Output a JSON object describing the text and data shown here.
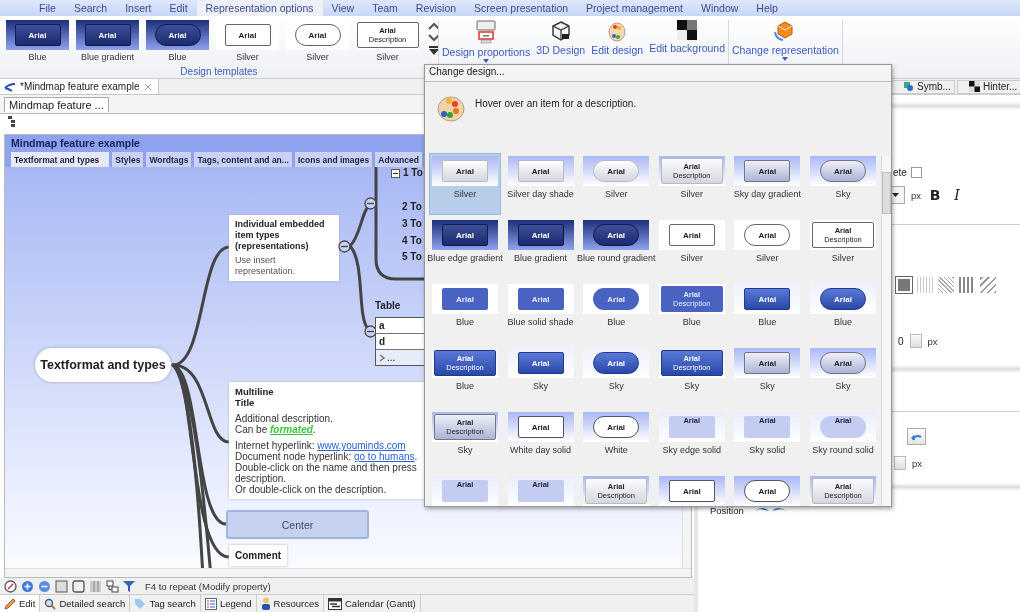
{
  "menu": [
    {
      "label": "File",
      "selected": false
    },
    {
      "label": "Search",
      "selected": false
    },
    {
      "label": "Insert",
      "selected": false
    },
    {
      "label": "Edit",
      "selected": false
    },
    {
      "label": "Representation options",
      "selected": true
    },
    {
      "label": "View",
      "selected": false
    },
    {
      "label": "Team",
      "selected": false
    },
    {
      "label": "Revision",
      "selected": false
    },
    {
      "label": "Screen presentation",
      "selected": false
    },
    {
      "label": "Project management",
      "selected": false
    },
    {
      "label": "Window",
      "selected": false
    },
    {
      "label": "Help",
      "selected": false
    }
  ],
  "ribbon": {
    "templates": [
      {
        "label": "Blue",
        "title": "Arial",
        "rounded": false,
        "kind": "navy"
      },
      {
        "label": "Blue gradient",
        "title": "Arial",
        "rounded": false,
        "kind": "navy"
      },
      {
        "label": "Blue",
        "title": "Arial",
        "rounded": true,
        "kind": "navy"
      },
      {
        "label": "Silver",
        "title": "Arial",
        "rounded": false,
        "kind": "outline"
      },
      {
        "label": "Silver",
        "title": "Arial",
        "rounded": true,
        "kind": "outline"
      },
      {
        "label": "Silver",
        "title": "Arial",
        "description": "Description",
        "rounded": false,
        "kind": "outline"
      }
    ],
    "group_label": "Design templates",
    "buttons": [
      {
        "label": "Design proportions",
        "dropdown": true
      },
      {
        "label": "3D Design",
        "dropdown": false
      },
      {
        "label": "Edit design",
        "dropdown": false
      },
      {
        "label": "Edit background",
        "dropdown": false
      },
      {
        "label": "Change representation",
        "dropdown": true
      }
    ]
  },
  "editor": {
    "document_tab": "*Mindmap feature example",
    "view_tab": "Mindmap feature ...",
    "map_title": "Mindmap feature example",
    "map_tabs": [
      {
        "label": "Textformat and types",
        "selected": true
      },
      {
        "label": "Styles",
        "selected": false
      },
      {
        "label": "Wordtags",
        "selected": false
      },
      {
        "label": "Tags, content and an...",
        "selected": false
      },
      {
        "label": "Icons and images",
        "selected": false
      },
      {
        "label": "Advanced",
        "selected": false
      }
    ],
    "root": "Textformat and types",
    "embedded": {
      "title": "Individual embedded item types (representations)",
      "description": "Use insert representation."
    },
    "topics": [
      "1 To",
      "2 To",
      "3 To",
      "4 To",
      "5 To"
    ],
    "table": {
      "label": "Table",
      "cells": [
        "a",
        "d",
        "..."
      ]
    },
    "multiline": {
      "title_lines": [
        "Multiline",
        "Title"
      ],
      "paragraphs": [
        "Additional description.",
        "Can be *formated*."
      ],
      "links": [
        {
          "prefix": "Internet hyperlink: ",
          "link": "www.youminds.com"
        },
        {
          "prefix": "Document node hyperlink: ",
          "link": "go to humans",
          "suffix": "."
        }
      ],
      "notes": [
        "Double-click on the name and then press description.",
        "Or double-click on the description."
      ]
    },
    "center": "Center",
    "comment": "Comment",
    "status": "F4 to repeat (Modify property)",
    "bottom_tabs": [
      {
        "label": "Edit",
        "selected": true
      },
      {
        "label": "Detailed search",
        "selected": false
      },
      {
        "label": "Tag search",
        "selected": false
      },
      {
        "label": "Legend",
        "selected": false
      },
      {
        "label": "Resources",
        "selected": false
      },
      {
        "label": "Calendar (Gantt)",
        "selected": false
      }
    ]
  },
  "side_panel": {
    "tabs": [
      {
        "label": "Symb...",
        "selected": false
      },
      {
        "label": "Hinter...",
        "selected": false
      }
    ],
    "checkbox_label": "ete",
    "checked": false,
    "unit": "px",
    "bold": "B",
    "italic": "I",
    "spin_value": "0",
    "unit_2": "px",
    "unit_3": "px",
    "position": "Position"
  },
  "popup": {
    "title": "Change design...",
    "hint": "Hover over an item for a description.",
    "items": [
      {
        "label": "Silver",
        "title": "Arial",
        "rounded": false,
        "kind": "silver",
        "selected": true
      },
      {
        "label": "Silver day shade",
        "title": "Arial",
        "rounded": false,
        "kind": "silver",
        "selected": false
      },
      {
        "label": "Silver",
        "title": "Arial",
        "rounded": true,
        "kind": "silver",
        "selected": false
      },
      {
        "label": "Silver",
        "title": "Arial",
        "description": "Description",
        "rounded": false,
        "kind": "silver",
        "selected": false
      },
      {
        "label": "Sky day gradient",
        "title": "Arial",
        "rounded": false,
        "kind": "sky",
        "selected": false
      },
      {
        "label": "Sky",
        "title": "Arial",
        "rounded": true,
        "kind": "sky",
        "selected": false
      },
      {
        "label": "Blue edge gradient",
        "title": "Arial",
        "rounded": false,
        "kind": "navy",
        "selected": false
      },
      {
        "label": "Blue gradient",
        "title": "Arial",
        "rounded": false,
        "kind": "navy",
        "selected": false
      },
      {
        "label": "Blue round gradient",
        "title": "Arial",
        "rounded": true,
        "kind": "navy",
        "selected": false
      },
      {
        "label": "Silver",
        "title": "Arial",
        "rounded": false,
        "kind": "outline",
        "selected": false
      },
      {
        "label": "Silver",
        "title": "Arial",
        "rounded": true,
        "kind": "outline",
        "selected": false
      },
      {
        "label": "Silver",
        "title": "Arial",
        "description": "Description",
        "rounded": false,
        "kind": "outline",
        "selected": false
      },
      {
        "label": "Blue",
        "title": "Arial",
        "rounded": false,
        "kind": "blue",
        "selected": false
      },
      {
        "label": "Blue solid shade",
        "title": "Arial",
        "rounded": false,
        "kind": "blue",
        "selected": false
      },
      {
        "label": "Blue",
        "title": "Arial",
        "rounded": true,
        "kind": "blue",
        "selected": false
      },
      {
        "label": "Blue",
        "title": "Arial",
        "description": "Description",
        "rounded": false,
        "kind": "blue",
        "selected": false
      },
      {
        "label": "Blue",
        "title": "Arial",
        "rounded": false,
        "kind": "royal",
        "selected": false
      },
      {
        "label": "Blue",
        "title": "Arial",
        "rounded": true,
        "kind": "royal",
        "selected": false
      },
      {
        "label": "Blue",
        "title": "Arial",
        "description": "Description",
        "rounded": false,
        "kind": "royal",
        "selected": false
      },
      {
        "label": "Sky",
        "title": "Arial",
        "rounded": false,
        "kind": "royal",
        "selected": false
      },
      {
        "label": "Sky",
        "title": "Arial",
        "rounded": true,
        "kind": "royal",
        "selected": false
      },
      {
        "label": "Sky",
        "title": "Arial",
        "description": "Description",
        "rounded": false,
        "kind": "royal",
        "selected": false
      },
      {
        "label": "Sky",
        "title": "Arial",
        "rounded": false,
        "kind": "sky",
        "selected": false
      },
      {
        "label": "Sky",
        "title": "Arial",
        "rounded": true,
        "kind": "sky",
        "selected": false
      },
      {
        "label": "Sky",
        "title": "Arial",
        "description": "Description",
        "rounded": false,
        "kind": "sky",
        "selected": false
      },
      {
        "label": "White day solid",
        "title": "Arial",
        "rounded": false,
        "kind": "white",
        "selected": false
      },
      {
        "label": "White",
        "title": "Arial",
        "rounded": true,
        "kind": "white",
        "selected": false
      },
      {
        "label": "Sky edge solid",
        "title": "Arial",
        "rounded": false,
        "kind": "pale",
        "selected": false
      },
      {
        "label": "Sky solid",
        "title": "Arial",
        "rounded": false,
        "kind": "pale",
        "selected": false
      },
      {
        "label": "Sky round solid",
        "title": "Arial",
        "rounded": true,
        "kind": "pale",
        "selected": false
      },
      {
        "title": "Arial",
        "rounded": false,
        "kind": "pale",
        "selected": false
      },
      {
        "title": "Arial",
        "rounded": false,
        "kind": "pale",
        "selected": false
      },
      {
        "title": "Arial",
        "description": "Description",
        "rounded": false,
        "kind": "silver",
        "selected": false
      },
      {
        "title": "Arial",
        "rounded": false,
        "kind": "white",
        "selected": false
      },
      {
        "title": "Arial",
        "rounded": true,
        "kind": "white",
        "selected": false
      },
      {
        "title": "Arial",
        "description": "Description",
        "rounded": false,
        "kind": "silver",
        "selected": false
      }
    ]
  }
}
